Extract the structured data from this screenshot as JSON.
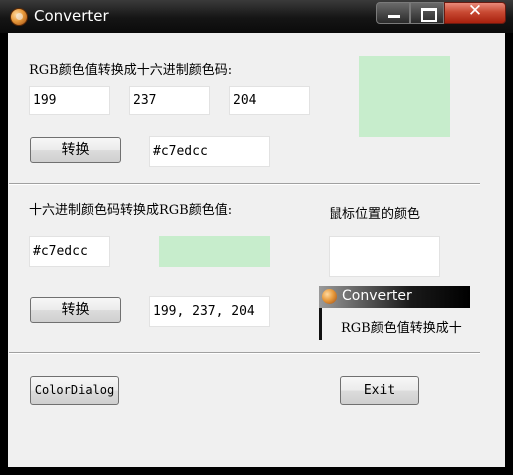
{
  "window": {
    "title": "Converter",
    "close_glyph": "✕"
  },
  "section1": {
    "label": "RGB颜色值转换成十六进制颜色码:",
    "r": "199",
    "g": "237",
    "b": "204",
    "button": "转换",
    "hex_result": "#c7edcc",
    "swatch_color": "#c7edcc"
  },
  "section2": {
    "label": "十六进制颜色码转换成RGB颜色值:",
    "hex_input": "#c7edcc",
    "swatch_color": "#c7edcc",
    "button": "转换",
    "rgb_result": "199, 237, 204"
  },
  "mouse": {
    "label": "鼠标位置的颜色",
    "preview_title": "Converter",
    "preview_text": "RGB颜色值转换成十"
  },
  "bottom": {
    "color_dialog": "ColorDialog",
    "exit": "Exit"
  },
  "colors": {
    "swatch": "#c7edcc",
    "close_button": "#c84a33",
    "client_bg": "#f0f0f0"
  }
}
